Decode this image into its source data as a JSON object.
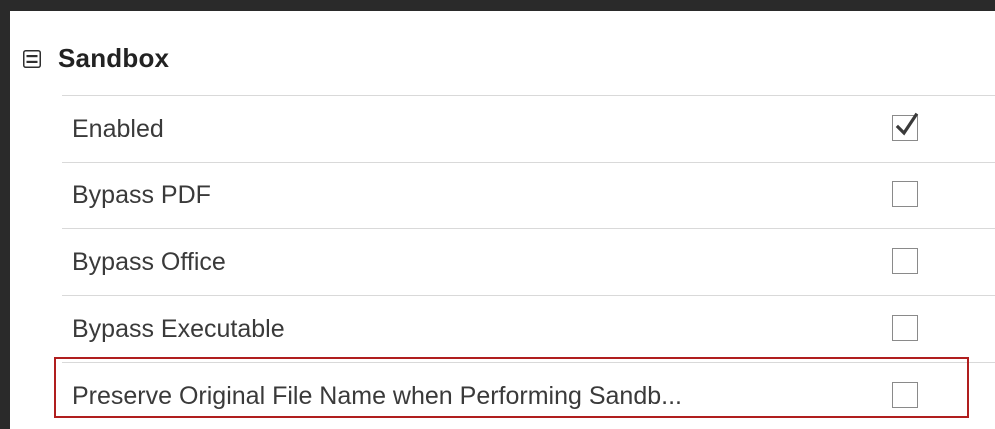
{
  "section": {
    "title": "Sandbox",
    "expanded": true
  },
  "rows": [
    {
      "label": "Enabled",
      "checked": true
    },
    {
      "label": "Bypass PDF",
      "checked": false
    },
    {
      "label": "Bypass Office",
      "checked": false
    },
    {
      "label": "Bypass Executable",
      "checked": false
    },
    {
      "label": "Preserve Original File Name when Performing Sandb...",
      "checked": false,
      "highlighted": true
    }
  ],
  "colors": {
    "highlight": "#b01e1e",
    "text": "#3a3a3a",
    "header_text": "#222222",
    "frame": "#2a2a2a"
  }
}
